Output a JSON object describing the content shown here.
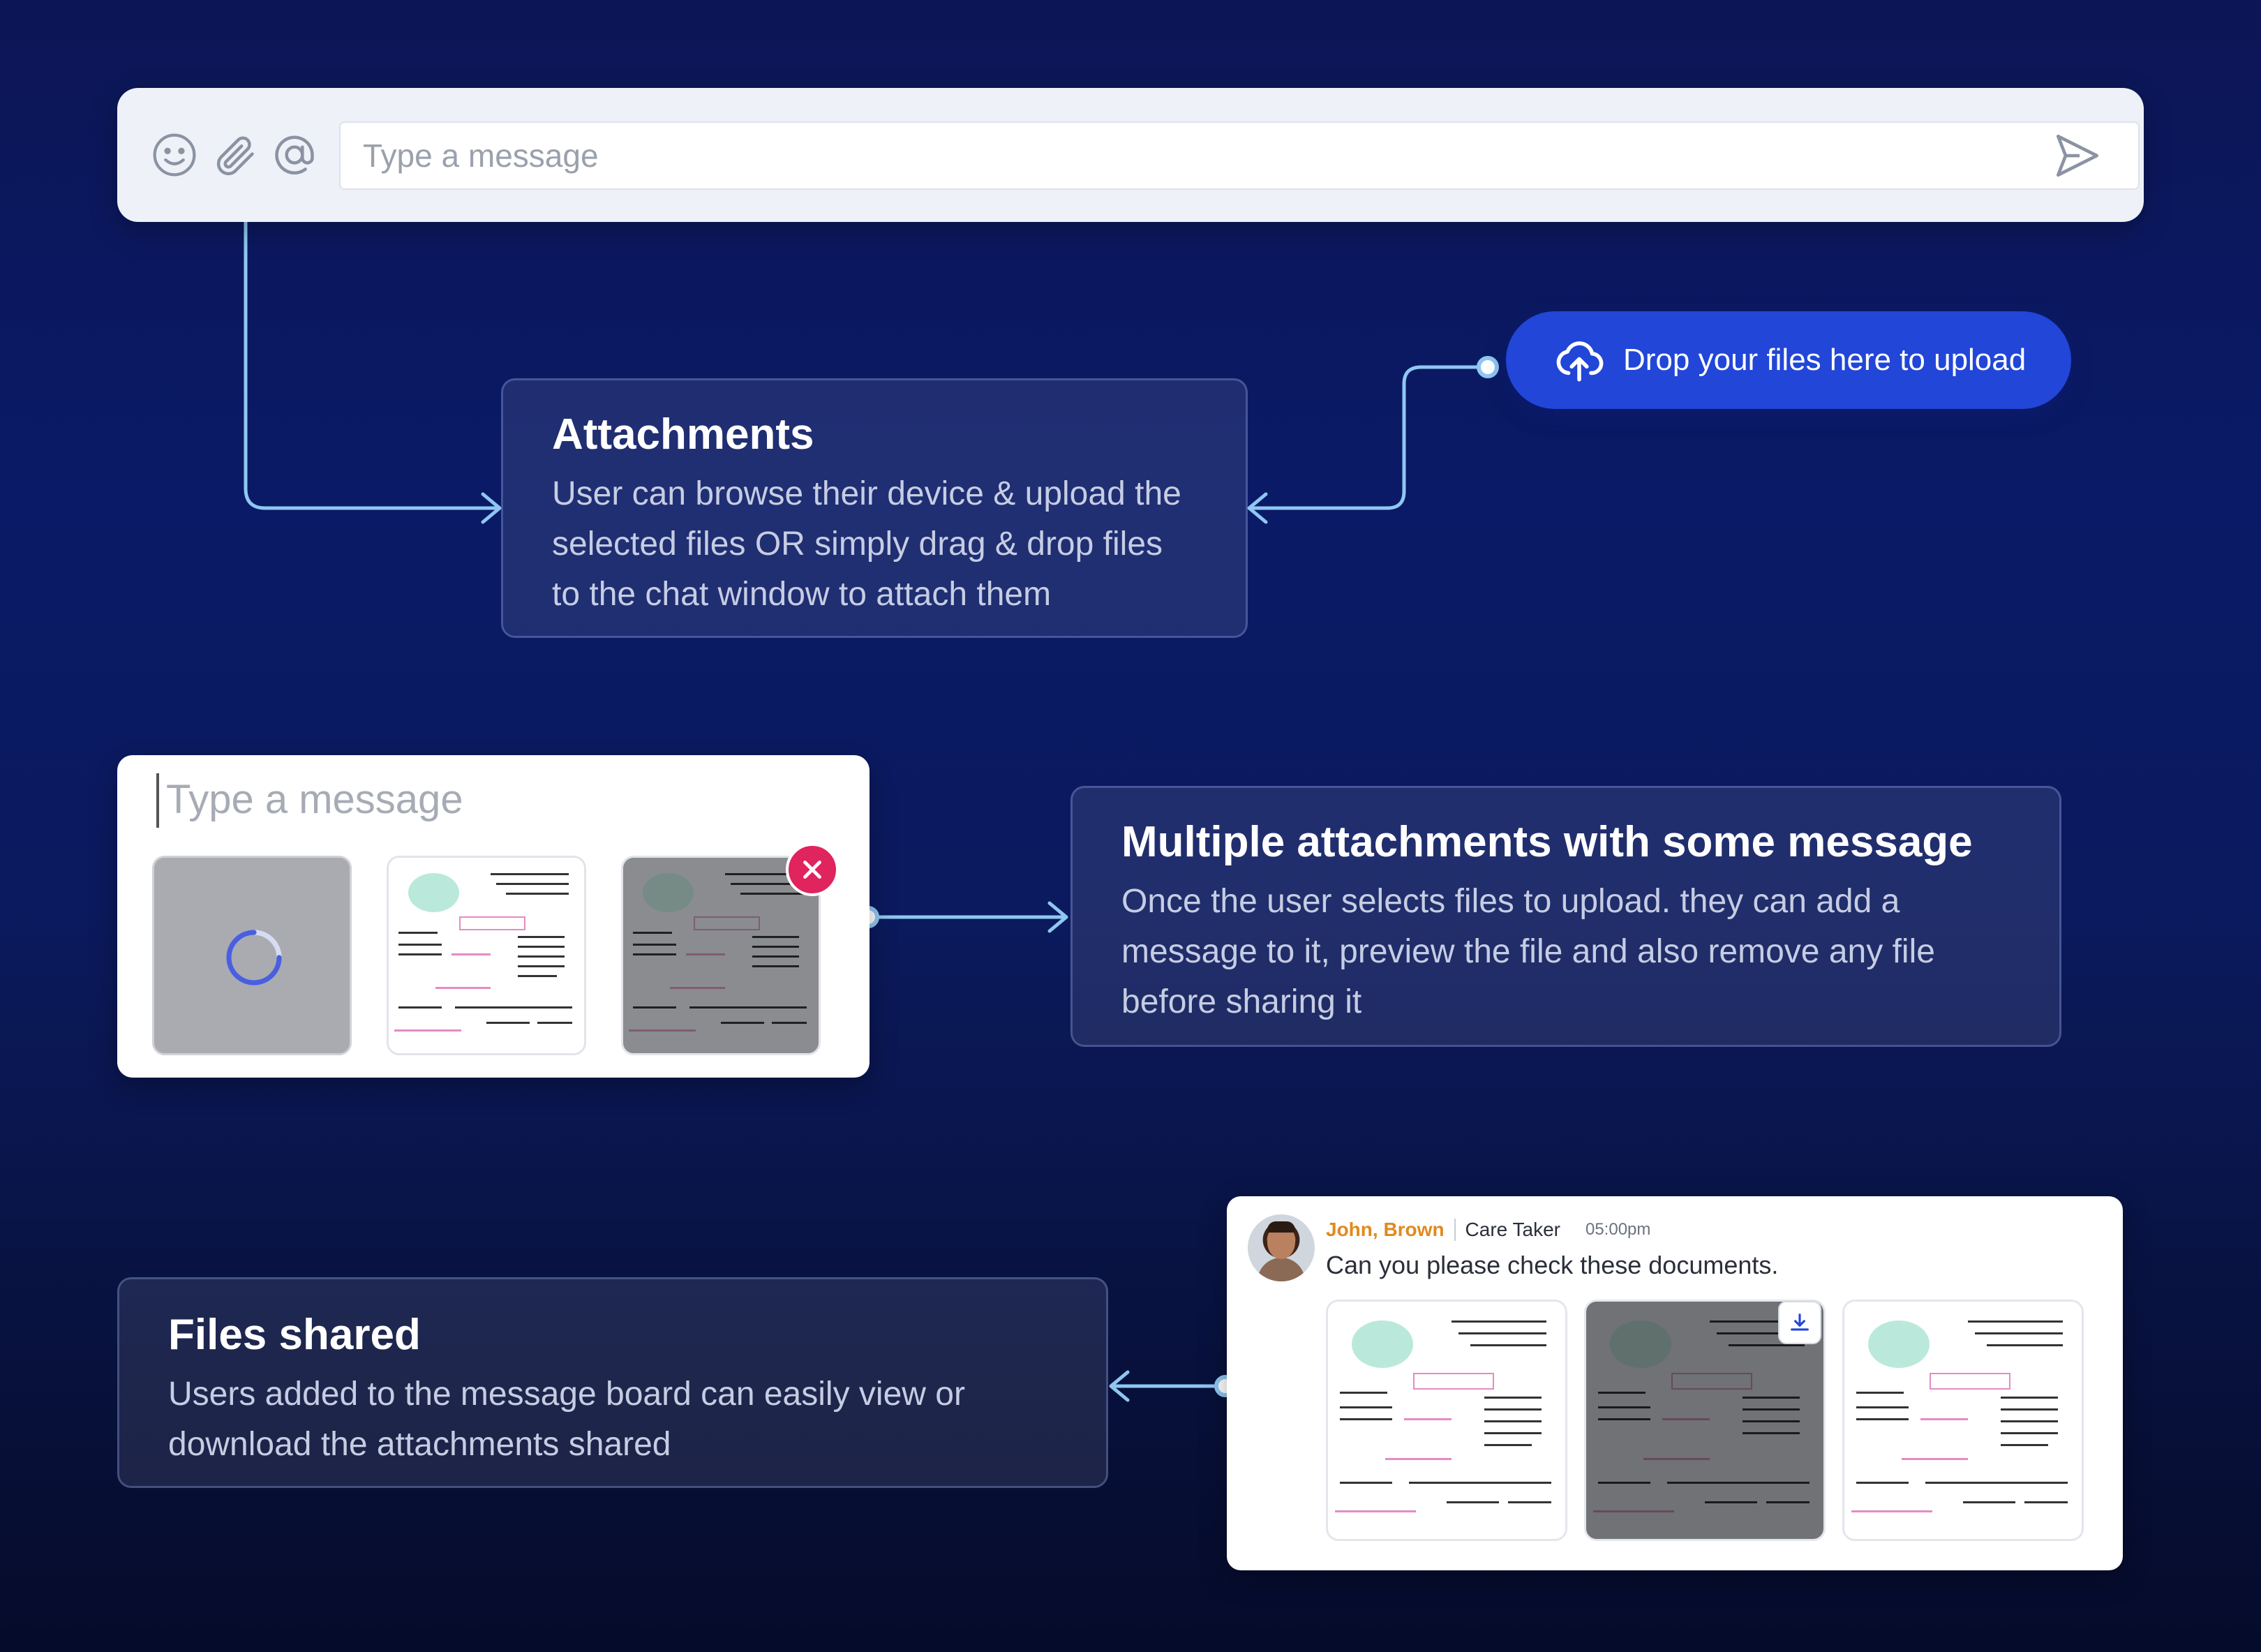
{
  "chat_bar": {
    "placeholder": "Type a message",
    "icons": [
      "emoji-icon",
      "paperclip-icon",
      "at-mention-icon",
      "send-icon"
    ]
  },
  "upload": {
    "label": "Drop your files here to upload",
    "icon": "cloud-upload-icon"
  },
  "attachments_card": {
    "title": "Attachments",
    "body": "User can browse their device & upload the selected files OR simply drag & drop files to the chat window to attach them"
  },
  "composer": {
    "placeholder": "Type a message",
    "attachments": [
      "loading",
      "document",
      "document-selected"
    ]
  },
  "multi_card": {
    "title": "Multiple attachments with some message",
    "body": "Once the user selects files to upload. they can add a message to it, preview the file and also remove any file before sharing it"
  },
  "files_card": {
    "title": "Files shared",
    "body": "Users added to the message board can easily view or download the attachments shared"
  },
  "shared_message": {
    "author": "John, Brown",
    "role": "Care Taker",
    "time": "05:00pm",
    "text": "Can you please check these documents."
  },
  "colors": {
    "accent_blue": "#2146d8",
    "remove_red": "#e0245e",
    "author_orange": "#e08a1e",
    "connector": "#8fc7f2"
  }
}
